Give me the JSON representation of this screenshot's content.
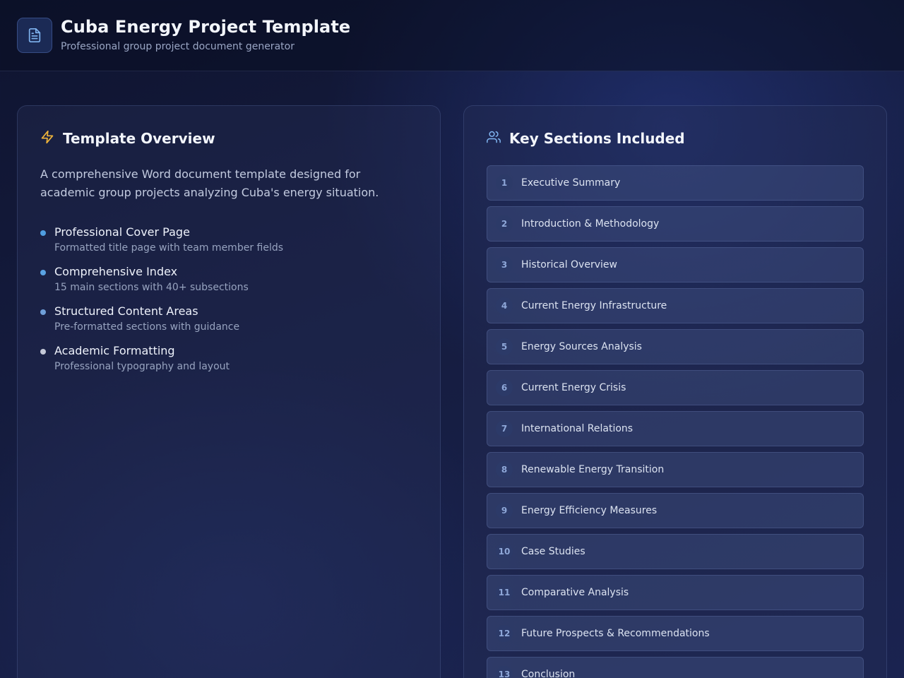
{
  "header": {
    "icon": "document-icon",
    "title": "Cuba Energy Project Template",
    "subtitle": "Professional group project document generator"
  },
  "overview": {
    "icon": "lightning-icon",
    "heading": "Template Overview",
    "description": "A comprehensive Word document template designed for academic group projects analyzing Cuba's energy situation.",
    "features": [
      {
        "title": "Professional Cover Page",
        "desc": "Formatted title page with team member fields",
        "dot_color": "#4f9de0"
      },
      {
        "title": "Comprehensive Index",
        "desc": "15 main sections with 40+ subsections",
        "dot_color": "#5aa3e3"
      },
      {
        "title": "Structured Content Areas",
        "desc": "Pre-formatted sections with guidance",
        "dot_color": "#6f9fd8"
      },
      {
        "title": "Academic Formatting",
        "desc": "Professional typography and layout",
        "dot_color": "#c4c9d8"
      }
    ]
  },
  "sections_panel": {
    "icon": "users-icon",
    "heading": "Key Sections Included",
    "items": [
      {
        "num": "1",
        "label": "Executive Summary"
      },
      {
        "num": "2",
        "label": "Introduction & Methodology"
      },
      {
        "num": "3",
        "label": "Historical Overview"
      },
      {
        "num": "4",
        "label": "Current Energy Infrastructure"
      },
      {
        "num": "5",
        "label": "Energy Sources Analysis"
      },
      {
        "num": "6",
        "label": "Current Energy Crisis"
      },
      {
        "num": "7",
        "label": "International Relations"
      },
      {
        "num": "8",
        "label": "Renewable Energy Transition"
      },
      {
        "num": "9",
        "label": "Energy Efficiency Measures"
      },
      {
        "num": "10",
        "label": "Case Studies"
      },
      {
        "num": "11",
        "label": "Comparative Analysis"
      },
      {
        "num": "12",
        "label": "Future Prospects & Recommendations"
      },
      {
        "num": "13",
        "label": "Conclusion"
      }
    ]
  },
  "colors": {
    "accent_blue": "#5b9be0",
    "lightning_yellow": "#f0b53a"
  }
}
